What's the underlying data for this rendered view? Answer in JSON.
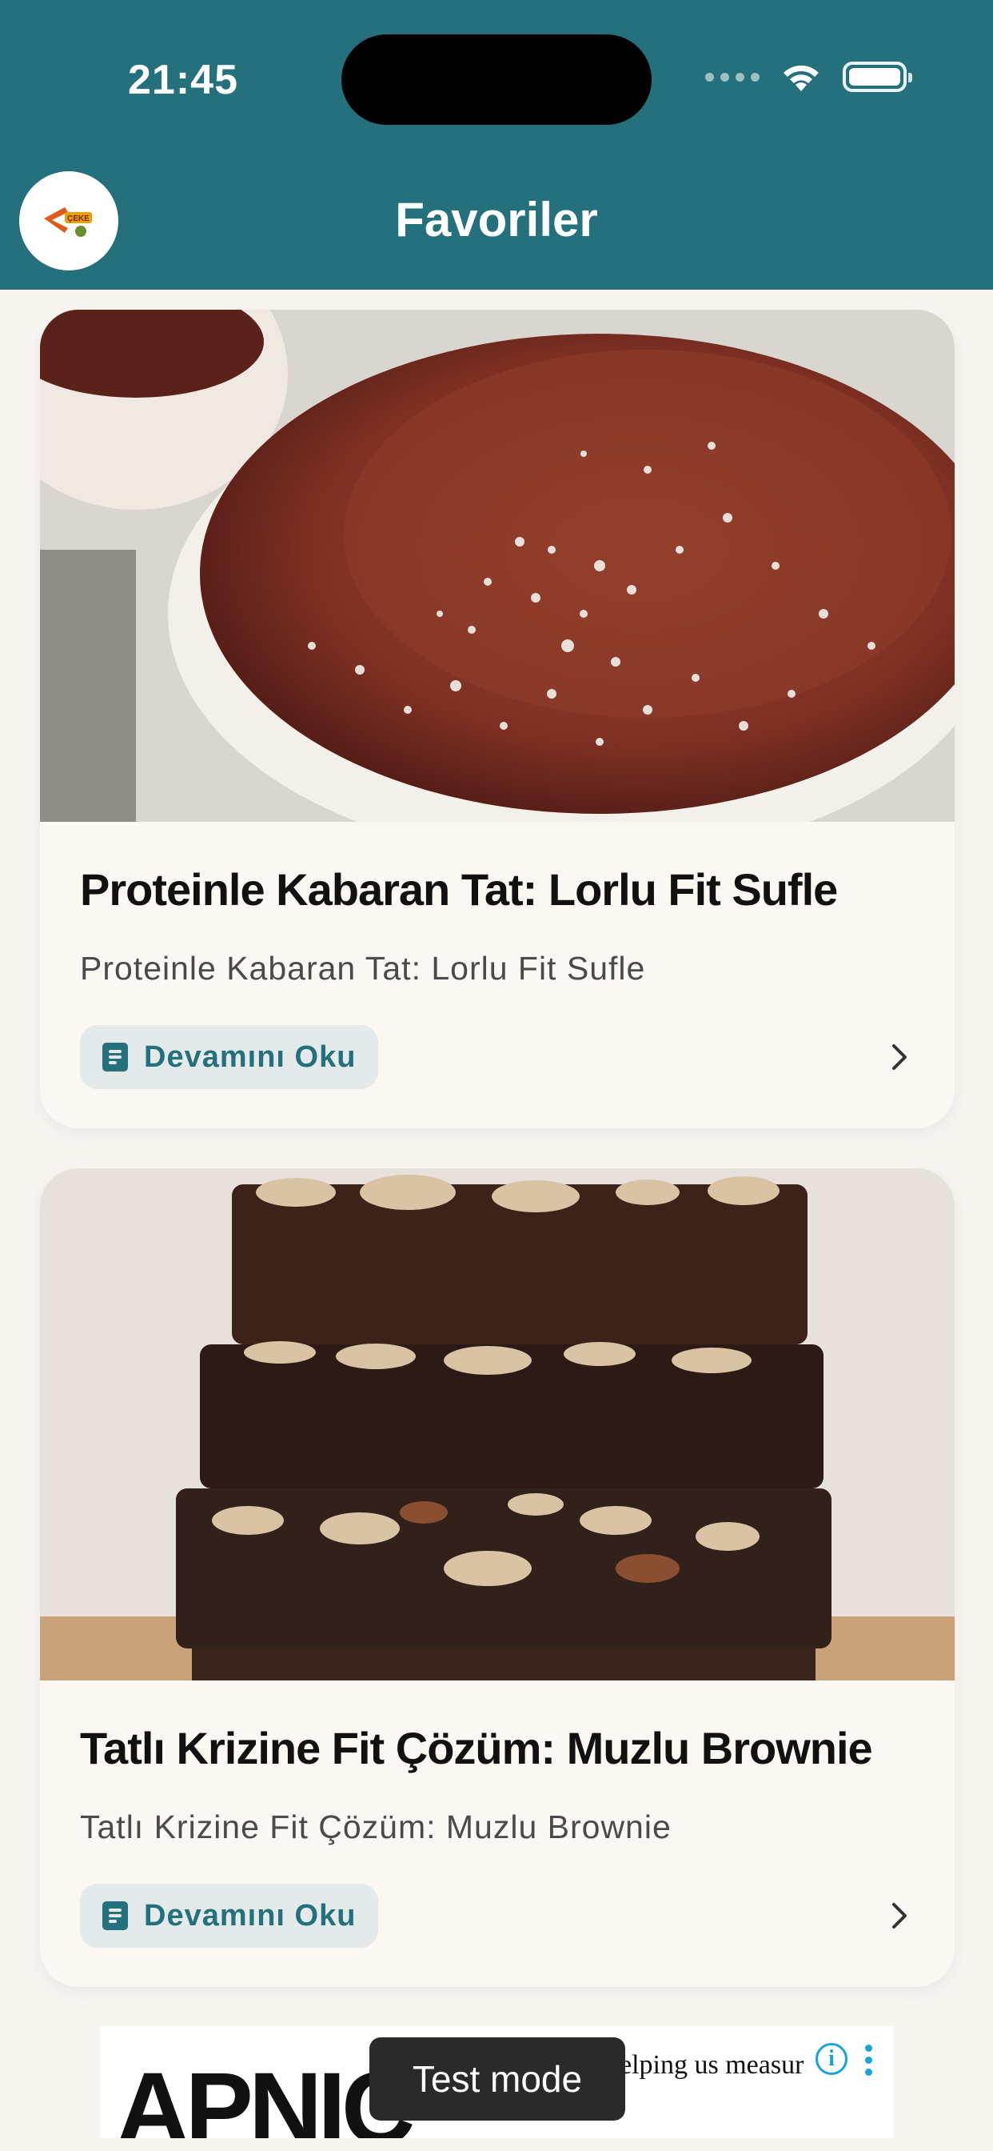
{
  "status_bar": {
    "time": "21:45",
    "icons": [
      "cellular-signal-icon",
      "wifi-icon",
      "battery-icon"
    ]
  },
  "header": {
    "title": "Favoriler",
    "logo_icon": "app-logo-icon"
  },
  "colors": {
    "header_bg": "#24707d",
    "page_bg": "#f8f5f1",
    "card_bg": "#fbf8f4",
    "accent": "#24707d"
  },
  "recipes": [
    {
      "title": "Proteinle Kabaran Tat: Lorlu Fit Sufle",
      "subtitle": "Proteinle Kabaran Tat: Lorlu Fit Sufle",
      "button_label": "Devamını Oku",
      "image": "chocolate-souffle-with-coconut-photo"
    },
    {
      "title": "Tatlı Krizine Fit Çözüm: Muzlu Brownie",
      "subtitle": "Tatlı Krizine Fit Çözüm: Muzlu Brownie",
      "button_label": "Devamını Oku",
      "image": "stacked-almond-brownies-photo"
    }
  ],
  "ad": {
    "brand": "APNIC",
    "text": "elping us measur",
    "toast": "Test mode"
  }
}
